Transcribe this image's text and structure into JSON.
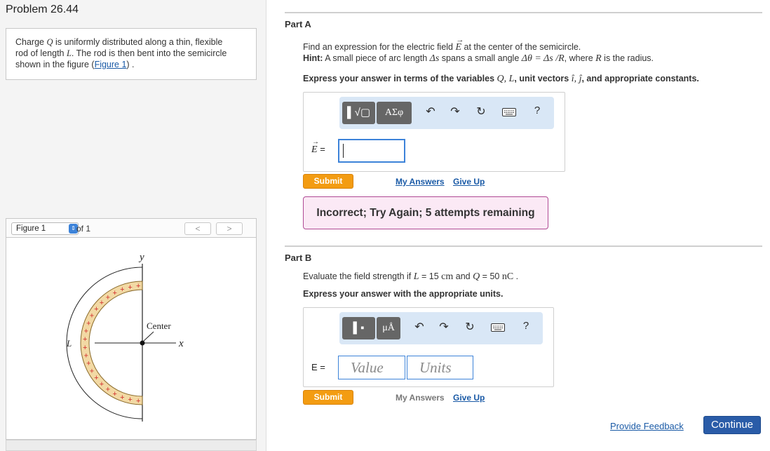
{
  "problem": {
    "title": "Problem 26.44",
    "statement": {
      "line1_pre": "Charge ",
      "line1_var": "Q",
      "line1_post": " is uniformly distributed along a thin, flexible",
      "line2_pre": "rod of length ",
      "line2_var": "L",
      "line2_post": ". The rod is then bent into the semicircle",
      "line3_pre": "shown in the figure (",
      "line3_link": "Figure 1",
      "line3_post": ") ."
    }
  },
  "figure_nav": {
    "selected": "Figure 1",
    "of_label": "of 1",
    "prev": "<",
    "next": ">"
  },
  "figure": {
    "y_label": "y",
    "x_label": "x",
    "L_label": "L",
    "center_label": "Center",
    "plus": "+"
  },
  "partA": {
    "title": "Part A",
    "q_pre": "Find an expression for the electric field ",
    "q_var": "E",
    "q_post": " at the center of the semicircle.",
    "hint_label": "Hint:",
    "hint_pre": " A small piece of arc length ",
    "hint_ds": "Δs",
    "hint_mid": " spans a small angle ",
    "hint_eq": "Δθ = Δs /R",
    "hint_where": ", where ",
    "hint_R": "R",
    "hint_post": " is the radius.",
    "express_pre": "Express your answer in terms of the variables ",
    "express_vars": "Q, L",
    "express_mid": ", unit vectors ",
    "express_units": "î, ĵ",
    "express_post": ", and appropriate constants.",
    "toolbar": {
      "templates": "▌√▢",
      "greek": "ΑΣφ",
      "help": "?"
    },
    "eq_label": "E",
    "eq_sign": "=",
    "submit": "Submit",
    "my_answers": "My Answers",
    "give_up": "Give Up",
    "feedback": "Incorrect; Try Again; 5 attempts remaining"
  },
  "partB": {
    "title": "Part B",
    "q_pre": "Evaluate the field strength if ",
    "q_L": "L",
    "q_mid1": " = 15 ",
    "q_cm": "cm",
    "q_mid2": " and ",
    "q_Q": "Q",
    "q_mid3": " = 50 ",
    "q_nC": "nC",
    "q_post": " .",
    "express": "Express your answer with the appropriate units.",
    "toolbar": {
      "templates": "▌▪",
      "units": "μÅ",
      "help": "?"
    },
    "eq_label": "E =",
    "value_placeholder": "Value",
    "units_placeholder": "Units",
    "submit": "Submit",
    "my_answers": "My Answers",
    "give_up": "Give Up"
  },
  "footer": {
    "provide_feedback": "Provide Feedback",
    "continue": "Continue"
  }
}
